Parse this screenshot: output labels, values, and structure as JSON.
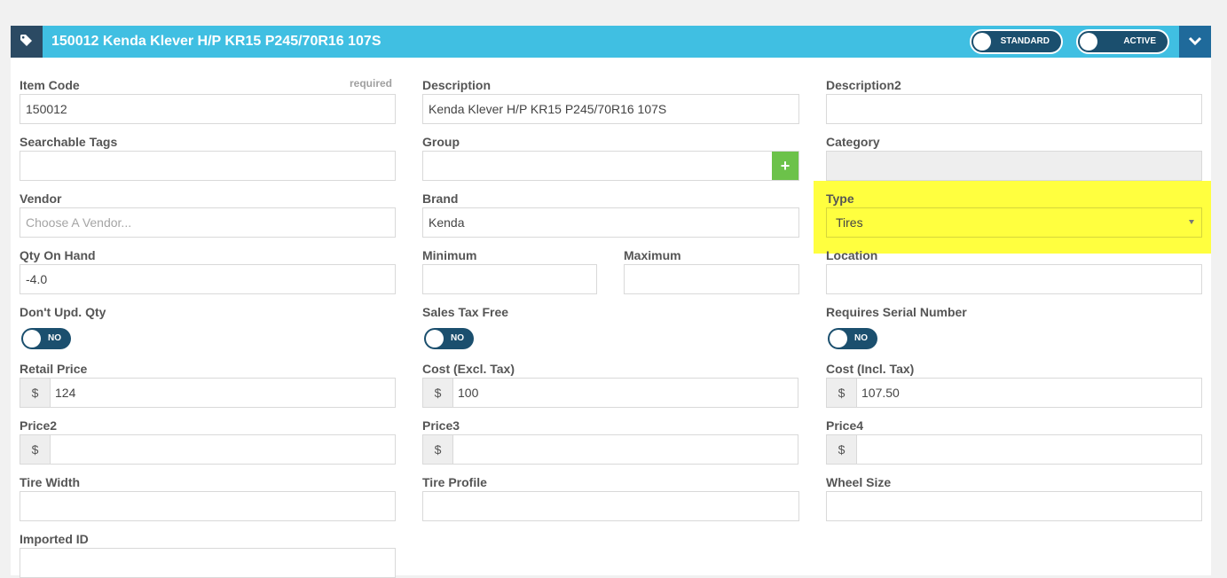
{
  "header": {
    "title": "150012 Kenda Klever H/P KR15 P245/70R16 107S",
    "toggle_standard": "STANDARD",
    "toggle_active": "ACTIVE"
  },
  "fields": {
    "item_code": {
      "label": "Item Code",
      "required": "required",
      "value": "150012"
    },
    "description": {
      "label": "Description",
      "value": "Kenda Klever H/P KR15 P245/70R16 107S"
    },
    "description2": {
      "label": "Description2",
      "value": ""
    },
    "searchable_tags": {
      "label": "Searchable Tags",
      "value": ""
    },
    "group": {
      "label": "Group",
      "value": "",
      "add": "+"
    },
    "category": {
      "label": "Category",
      "value": ""
    },
    "vendor": {
      "label": "Vendor",
      "placeholder": "Choose A Vendor..."
    },
    "brand": {
      "label": "Brand",
      "value": "Kenda"
    },
    "type": {
      "label": "Type",
      "value": "Tires"
    },
    "qty_on_hand": {
      "label": "Qty On Hand",
      "value": "-4.0"
    },
    "minimum": {
      "label": "Minimum",
      "value": ""
    },
    "maximum": {
      "label": "Maximum",
      "value": ""
    },
    "location": {
      "label": "Location",
      "value": ""
    },
    "dont_upd_qty": {
      "label": "Don't Upd. Qty",
      "state": "NO"
    },
    "sales_tax_free": {
      "label": "Sales Tax Free",
      "state": "NO"
    },
    "requires_serial": {
      "label": "Requires Serial Number",
      "state": "NO"
    },
    "retail_price": {
      "label": "Retail Price",
      "prefix": "$",
      "value": "124"
    },
    "cost_excl": {
      "label": "Cost (Excl. Tax)",
      "prefix": "$",
      "value": "100"
    },
    "cost_incl": {
      "label": "Cost (Incl. Tax)",
      "prefix": "$",
      "value": "107.50"
    },
    "price2": {
      "label": "Price2",
      "prefix": "$",
      "value": ""
    },
    "price3": {
      "label": "Price3",
      "prefix": "$",
      "value": ""
    },
    "price4": {
      "label": "Price4",
      "prefix": "$",
      "value": ""
    },
    "tire_width": {
      "label": "Tire Width",
      "value": ""
    },
    "tire_profile": {
      "label": "Tire Profile",
      "value": ""
    },
    "wheel_size": {
      "label": "Wheel Size",
      "value": ""
    },
    "imported_id": {
      "label": "Imported ID",
      "value": ""
    }
  },
  "colors": {
    "header_bg": "#40bfe2",
    "accent_dark": "#1b4f6e",
    "highlight": "#ffff3f",
    "add_button": "#6cc24a"
  }
}
